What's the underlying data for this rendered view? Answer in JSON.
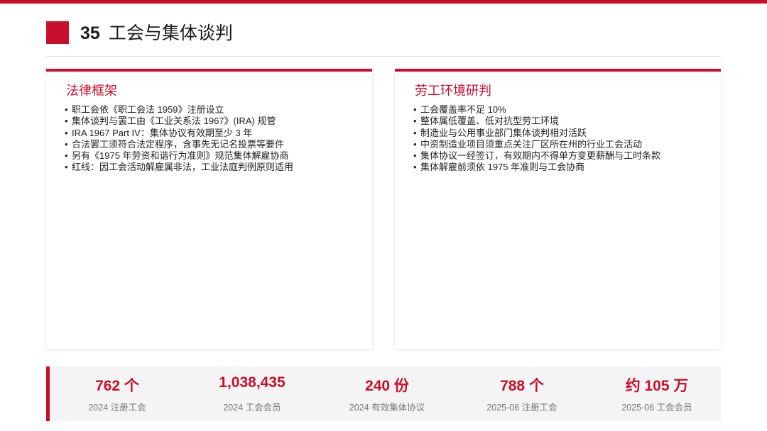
{
  "header": {
    "number": "35",
    "title": "工会与集体谈判"
  },
  "cards": {
    "legal": {
      "title": "法律框架",
      "items": [
        "职工会依《职工会法 1959》注册设立",
        "集体谈判与罢工由《工业关系法 1967》(IRA) 规管",
        "IRA 1967 Part IV：集体协议有效期至少 3 年",
        "合法罢工须符合法定程序，含事先无记名投票等要件",
        "另有《1975 年劳资和谐行为准则》规范集体解雇协商",
        "红线：因工会活动解雇属非法，工业法庭判例原则适用"
      ]
    },
    "assessment": {
      "title": "劳工环境研判",
      "items": [
        "工会覆盖率不足 10%",
        "整体属低覆盖、低对抗型劳工环境",
        "制造业与公用事业部门集体谈判相对活跃",
        "中资制造业项目须重点关注厂区所在州的行业工会活动",
        "集体协议一经签订，有效期内不得单方变更薪酬与工时条款",
        "集体解雇前须依 1975 年准则与工会协商"
      ]
    }
  },
  "stats": [
    {
      "value": "762 个",
      "label": "2024 注册工会"
    },
    {
      "value": "1,038,435",
      "label": "2024 工会会员"
    },
    {
      "value": "240 份",
      "label": "2024 有效集体协议"
    },
    {
      "value": "788 个",
      "label": "2025-06 注册工会"
    },
    {
      "value": "约 105 万",
      "label": "2025-06 工会会员"
    }
  ],
  "colors": {
    "accent": "#c8102e",
    "panel": "#f4f4f4",
    "muted": "#777777"
  }
}
